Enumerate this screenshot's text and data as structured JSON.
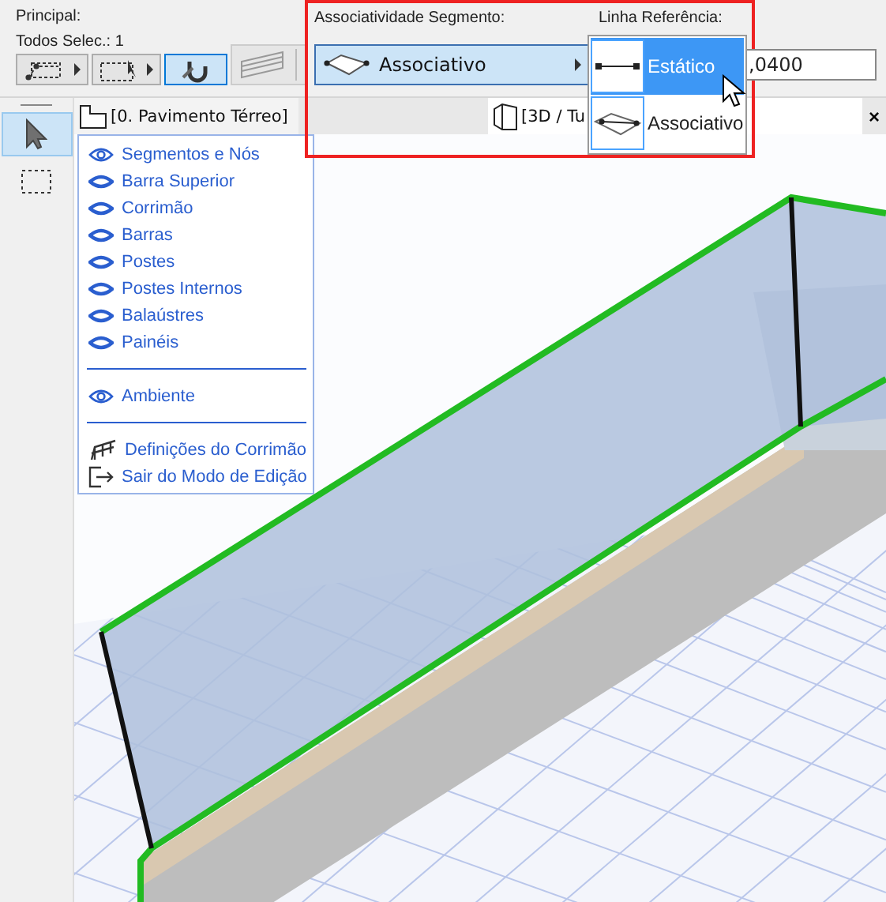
{
  "toolbar": {
    "group_label": "Principal:",
    "selection_label": "Todos Selec.: 1",
    "tools": [
      {
        "kind": "node-marquee",
        "selected": false
      },
      {
        "kind": "marquee-arrow",
        "selected": false
      },
      {
        "kind": "magnet",
        "selected": true
      },
      {
        "kind": "railing",
        "selected": false
      }
    ]
  },
  "toolbox": {
    "tools": [
      {
        "kind": "arrow",
        "selected": true
      },
      {
        "kind": "marquee",
        "selected": false
      }
    ]
  },
  "tabs": [
    {
      "label": "[0. Pavimento Térreo]",
      "kind": "plan",
      "selected": false
    },
    {
      "label": "[3D / Tu",
      "kind": "model",
      "selected": true
    }
  ],
  "close_label": "×",
  "context_menu": {
    "items": [
      {
        "kind": "eye",
        "label": "Segmentos e Nós",
        "visible": true
      },
      {
        "kind": "eye",
        "label": "Barra Superior",
        "visible": false
      },
      {
        "kind": "eye",
        "label": "Corrimão",
        "visible": false
      },
      {
        "kind": "eye",
        "label": "Barras",
        "visible": false
      },
      {
        "kind": "eye",
        "label": "Postes",
        "visible": false
      },
      {
        "kind": "eye",
        "label": "Postes Internos",
        "visible": false
      },
      {
        "kind": "eye",
        "label": "Balaústres",
        "visible": false
      },
      {
        "kind": "eye",
        "label": "Painéis",
        "visible": false
      },
      {
        "kind": "separator"
      },
      {
        "kind": "eye",
        "label": "Ambiente",
        "visible": true
      },
      {
        "kind": "separator"
      },
      {
        "kind": "railing-settings",
        "label": "Definições do Corrimão"
      },
      {
        "kind": "exit",
        "label": "Sair do Modo de Edição"
      }
    ]
  },
  "segment_panel": {
    "label": "Associatividade Segmento:",
    "button_label": "Associativo",
    "reference_label": "Linha Referência:",
    "value": ",0400",
    "options": [
      {
        "kind": "static",
        "label": "Estático",
        "selected": true
      },
      {
        "kind": "associative",
        "label": "Associativo",
        "selected": false
      }
    ]
  }
}
